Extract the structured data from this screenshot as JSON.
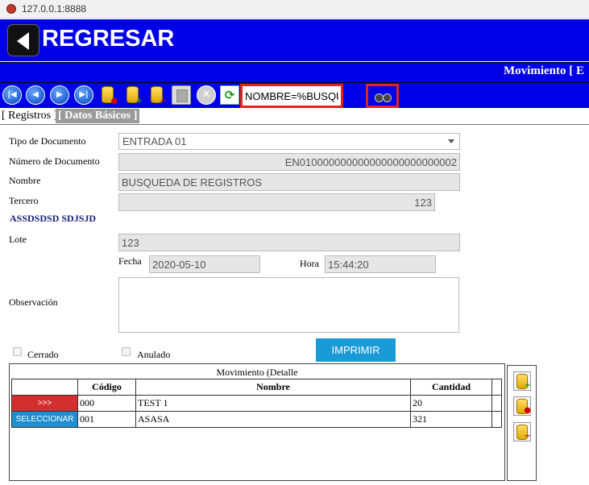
{
  "browser": {
    "url": "127.0.0.1:8888"
  },
  "header": {
    "title": "REGRESAR"
  },
  "subheader": {
    "title": "Movimiento [ E"
  },
  "toolbar": {
    "search_value": "NOMBRE=%BUSQU"
  },
  "tabs": {
    "registros": "[ Registros ]",
    "datos": "[ Datos Básicos ]"
  },
  "form": {
    "tipo_label": "Tipo de Documento",
    "tipo_value": "ENTRADA 01",
    "numero_label": "Número de Documento",
    "numero_value": "EN010000000000000000000000002",
    "nombre_label": "Nombre",
    "nombre_value": "BUSQUEDA DE REGISTROS",
    "tercero_label": "Tercero",
    "tercero_value": "123",
    "tercero_name": "ASSDSDSD SDJSJD",
    "lote_label": "Lote",
    "lote_value": "123",
    "fecha_label": "Fecha",
    "fecha_value": "2020-05-10",
    "hora_label": "Hora",
    "hora_value": "15:44:20",
    "observacion_label": "Observación",
    "cerrado_label": "Cerrado",
    "anulado_label": "Anulado",
    "imprimir_label": "IMPRIMIR"
  },
  "grid": {
    "caption": "Movimiento (Detalle",
    "columns": [
      "Código",
      "Nombre",
      "Cantidad"
    ],
    "rows": [
      {
        "action": ">>>",
        "codigo": "000",
        "nombre": "TEST 1",
        "cantidad": "20"
      },
      {
        "action": "SELECCIONAR",
        "codigo": "001",
        "nombre": "ASASA",
        "cantidad": "321"
      }
    ]
  }
}
